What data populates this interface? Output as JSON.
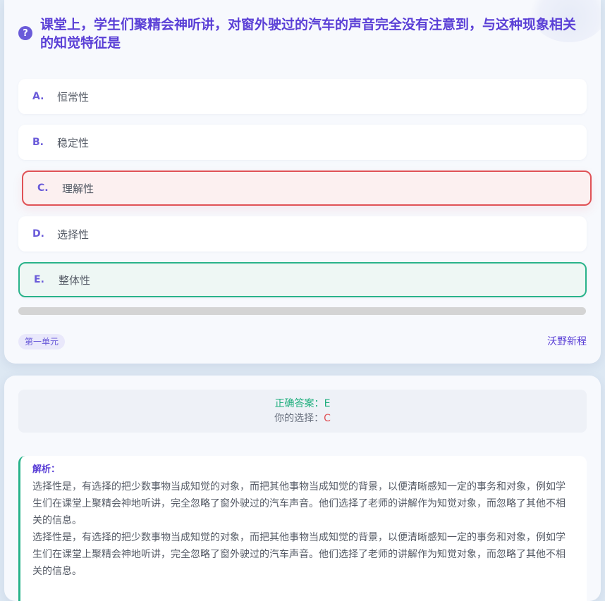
{
  "question": {
    "icon": "question-circle-icon",
    "text": "课堂上，学生们聚精会神听讲，对窗外驶过的汽车的声音完全没有注意到，与这种现象相关的知觉特征是"
  },
  "options": [
    {
      "letter": "A.",
      "text": "恒常性",
      "state": "default"
    },
    {
      "letter": "B.",
      "text": "稳定性",
      "state": "default"
    },
    {
      "letter": "C.",
      "text": "理解性",
      "state": "wrong"
    },
    {
      "letter": "D.",
      "text": "选择性",
      "state": "default"
    },
    {
      "letter": "E.",
      "text": "整体性",
      "state": "correct"
    }
  ],
  "footer": {
    "tag": "第一单元",
    "brand": "沃野新程"
  },
  "result": {
    "correct_label": "正确答案：",
    "correct_value": "E",
    "mine_label": "你的选择：",
    "mine_value": "C"
  },
  "analysis": {
    "title": "解析：",
    "paragraphs": [
      "选择性是，有选择的把少数事物当成知觉的对象，而把其他事物当成知觉的背景，以便清晰感知一定的事务和对象，例如学生们在课堂上聚精会神地听讲，完全忽略了窗外驶过的汽车声音。他们选择了老师的讲解作为知觉对象，而忽略了其他不相关的信息。",
      "选择性是，有选择的把少数事物当成知觉的对象，而把其他事物当成知觉的背景，以便清晰感知一定的事务和对象，例如学生们在课堂上聚精会神地听讲，完全忽略了窗外驶过的汽车声音。他们选择了老师的讲解作为知觉对象，而忽略了其他不相关的信息。"
    ]
  },
  "colors": {
    "accent": "#5a3fd6",
    "correct": "#29b38a",
    "wrong": "#e05256"
  }
}
